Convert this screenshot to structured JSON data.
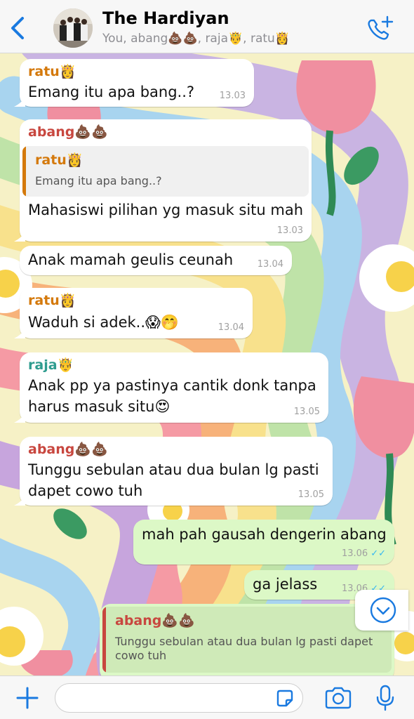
{
  "header": {
    "back_icon": "chevron-left-icon",
    "title": "The Hardiyan",
    "subtitle": "You, abang💩💩, raja🤴, ratu👸",
    "call_icon": "add-call-icon",
    "accent": "#1a7ae0"
  },
  "messages": [
    {
      "sender": "ratu👸",
      "sender_color": "#d4790c",
      "lines": [
        "Emang itu apa bang..?"
      ],
      "time": "13.03",
      "direction": "in"
    },
    {
      "sender": "abang💩💩",
      "sender_color": "#c8473f",
      "quote": {
        "name": "ratu👸",
        "text": "Emang itu apa bang..?",
        "color": "#d4790c"
      },
      "lines": [
        "Mahasiswi pilihan yg masuk situ mah"
      ],
      "time": "13.03",
      "direction": "in"
    },
    {
      "lines": [
        "Anak mamah geulis ceunah"
      ],
      "time": "13.04",
      "direction": "in"
    },
    {
      "sender": "ratu👸",
      "sender_color": "#d4790c",
      "lines": [
        "Waduh si adek..😱🤭"
      ],
      "time": "13.04",
      "direction": "in"
    },
    {
      "sender": "raja🤴",
      "sender_color": "#2f9c8f",
      "lines": [
        "Anak pp ya pastinya cantik donk tanpa",
        "harus masuk situ😍"
      ],
      "time": "13.05",
      "direction": "in"
    },
    {
      "sender": "abang💩💩",
      "sender_color": "#c8473f",
      "lines": [
        "Tunggu sebulan atau dua bulan lg pasti",
        "dapet cowo tuh"
      ],
      "time": "13.05",
      "direction": "in"
    },
    {
      "lines": [
        "mah pah gausah dengerin abang"
      ],
      "time": "13.06",
      "direction": "out",
      "ticks": "✓✓"
    },
    {
      "lines": [
        "ga jelass"
      ],
      "time": "13.06",
      "direction": "out",
      "ticks": "✓✓"
    },
    {
      "quote": {
        "name": "abang💩💩",
        "lines": [
          "Tunggu sebulan atau dua bulan lg pasti dapet",
          "cowo tuh"
        ],
        "color": "#c8473f"
      },
      "direction": "out"
    }
  ],
  "scroll_icon": "chevron-down-circle-icon",
  "composer": {
    "plus_icon": "plus-icon",
    "placeholder": "",
    "sticker_icon": "sticker-icon",
    "camera_icon": "camera-icon",
    "mic_icon": "microphone-icon"
  }
}
